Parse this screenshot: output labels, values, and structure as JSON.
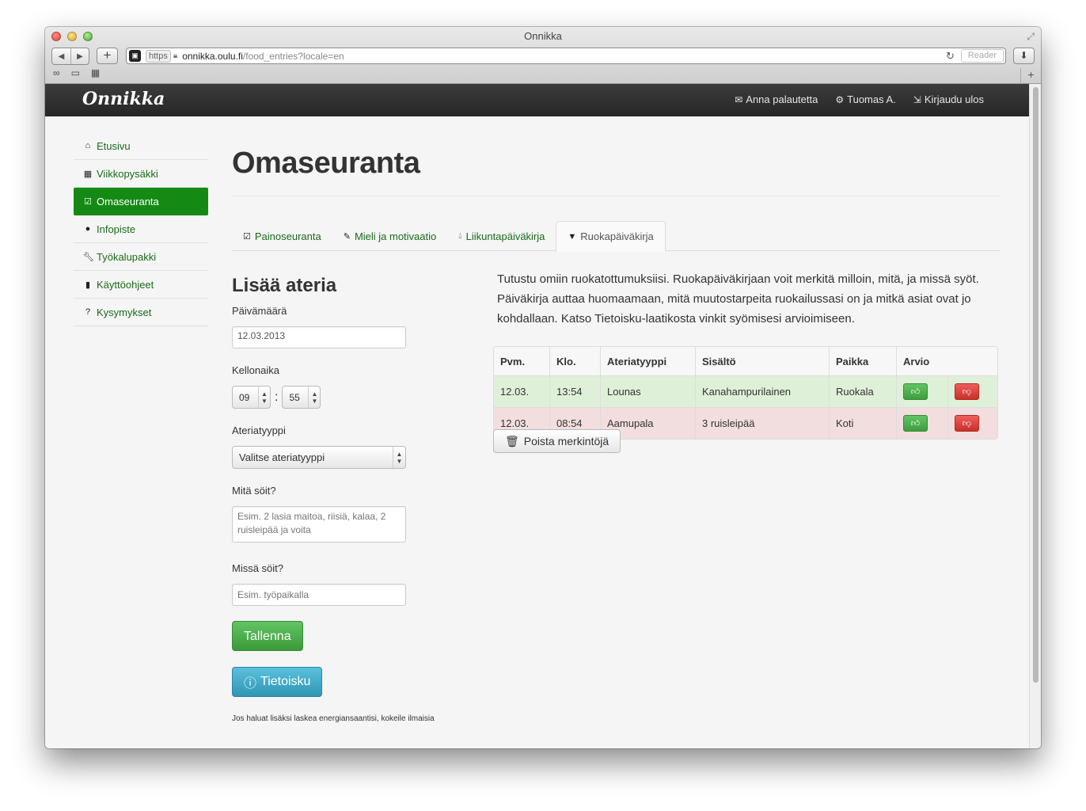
{
  "browser": {
    "window_title": "Onnikka",
    "url_scheme": "https",
    "url_host": "onnikka.oulu.fi",
    "url_path": "/food_entries?locale=en",
    "reader_label": "Reader"
  },
  "site": {
    "brand": "Onnikka",
    "topnav": [
      {
        "label": "Anna palautetta",
        "icon": "envelope-icon"
      },
      {
        "label": "Tuomas A.",
        "icon": "cog-icon"
      },
      {
        "label": "Kirjaudu ulos",
        "icon": "logout-icon"
      }
    ]
  },
  "sidebar": {
    "items": [
      {
        "label": "Etusivu",
        "icon": "home-icon",
        "active": false
      },
      {
        "label": "Viikkopysäkki",
        "icon": "calendar-icon",
        "active": false
      },
      {
        "label": "Omaseuranta",
        "icon": "check-icon",
        "active": true
      },
      {
        "label": "Infopiste",
        "icon": "info-icon",
        "active": false
      },
      {
        "label": "Työkalupakki",
        "icon": "wrench-icon",
        "active": false
      },
      {
        "label": "Käyttöohjeet",
        "icon": "book-icon",
        "active": false
      },
      {
        "label": "Kysymykset",
        "icon": "question-icon",
        "active": false
      }
    ]
  },
  "main": {
    "title": "Omaseuranta",
    "tabs": [
      {
        "label": "Painoseuranta",
        "icon": "check-icon",
        "active": false
      },
      {
        "label": "Mieli ja motivaatio",
        "icon": "pencil-icon",
        "active": false
      },
      {
        "label": "Liikuntapäiväkirja",
        "icon": "drop-icon",
        "active": false
      },
      {
        "label": "Ruokapäiväkirja",
        "icon": "glass-icon",
        "active": true
      }
    ]
  },
  "form": {
    "heading": "Lisää ateria",
    "date_label": "Päivämäärä",
    "date_value": "12.03.2013",
    "time_label": "Kellonaika",
    "hour": "09",
    "minute": "55",
    "time_separator": ":",
    "meal_type_label": "Ateriatyyppi",
    "meal_type_value": "Valitse ateriatyyppi",
    "what_label": "Mitä söit?",
    "what_placeholder": "Esim. 2 lasia maitoa, riisiä, kalaa, 2 ruisleipää ja voita",
    "where_label": "Missä söit?",
    "where_placeholder": "Esim. työpaikalla",
    "save_label": "Tallenna",
    "info_label": "Tietoisku",
    "footnote": "Jos haluat lisäksi laskea energiansaantisi, kokeile ilmaisia"
  },
  "intro": "Tutustu omiin ruokatottumuksiisi. Ruokapäiväkirjaan voit merkitä milloin, mitä, ja missä syöt. Päiväkirja auttaa huomaamaan, mitä muutostarpeita ruokailussasi on ja mitkä asiat ovat jo kohdallaan. Katso Tietoisku-laatikosta vinkit syömisesi arvioimiseen.",
  "table": {
    "headers": [
      "Pvm.",
      "Klo.",
      "Ateriatyyppi",
      "Sisältö",
      "Paikka",
      "Arvio"
    ],
    "rows": [
      {
        "date": "12.03.",
        "time": "13:54",
        "type": "Lounas",
        "content": "Kanahampurilainen",
        "place": "Ruokala",
        "rating": "good"
      },
      {
        "date": "12.03.",
        "time": "08:54",
        "type": "Aamupala",
        "content": "3 ruisleipää",
        "place": "Koti",
        "rating": "bad"
      }
    ]
  },
  "delete_label": "Poista merkintöjä",
  "colors": {
    "accent_green": "#148a14",
    "link_green": "#1a6b1a",
    "row_good": "#dff0d8",
    "row_bad": "#f2dede",
    "info_blue": "#2f96b4",
    "navbar": "#2b2b2b"
  }
}
